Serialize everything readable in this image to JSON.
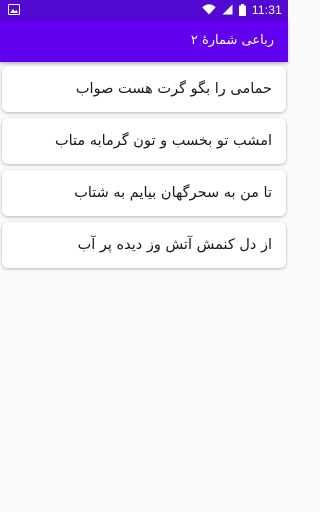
{
  "status_bar": {
    "time": "11:31",
    "left_icon": "image-icon",
    "icons": [
      "wifi-icon",
      "signal-icon",
      "battery-icon"
    ],
    "color": "#5209d1"
  },
  "app_bar": {
    "title": "رباعی شمارهٔ ۲",
    "color": "#6100ee"
  },
  "poem": {
    "lines": [
      "حمامی را بگو گرت هست صواب",
      "امشب تو بخسب و تون گرمابه متاب",
      "تا من به سحرگهان بیایم به شتاب",
      "از دل کنمش آتش وز دیده پر آب"
    ]
  }
}
